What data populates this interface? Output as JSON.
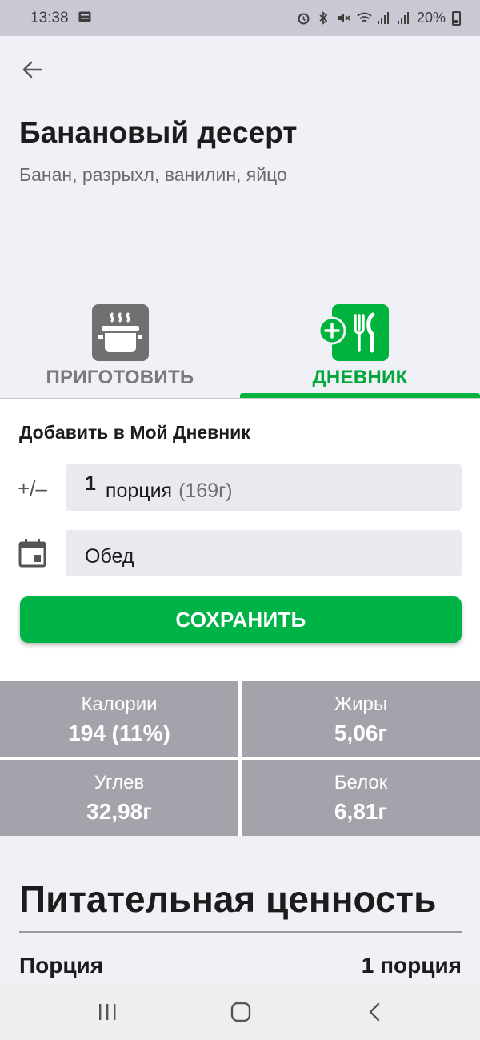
{
  "status_bar": {
    "time": "13:38",
    "battery": "20%"
  },
  "recipe": {
    "title": "Банановый десерт",
    "ingredients": "Банан, разрыхл, ванилин, яйцо"
  },
  "tabs": [
    {
      "label": "ПРИГОТОВИТЬ",
      "icon": "pot-icon",
      "active": false
    },
    {
      "label": "ДНЕВНИК",
      "icon": "add-meal-icon",
      "active": true
    }
  ],
  "add_to_diary": {
    "title": "Добавить в Мой Дневник",
    "quantity_icon": "+/–",
    "quantity": "1",
    "unit": "порция",
    "grams": "(169г)",
    "meal": "Обед",
    "save_label": "СОХРАНИТЬ"
  },
  "nutrients": [
    {
      "label": "Калории",
      "value": "194 (11%)"
    },
    {
      "label": "Жиры",
      "value": "5,06г"
    },
    {
      "label": "Углев",
      "value": "32,98г"
    },
    {
      "label": "Белок",
      "value": "6,81г"
    }
  ],
  "nutrition_facts": {
    "title": "Питательная ценность",
    "portion_label": "Порция",
    "portion_value": "1 порция"
  },
  "colors": {
    "accent": "#00b347",
    "stat_bg": "#a3a4ab",
    "page_bg": "#f0f0f7"
  }
}
